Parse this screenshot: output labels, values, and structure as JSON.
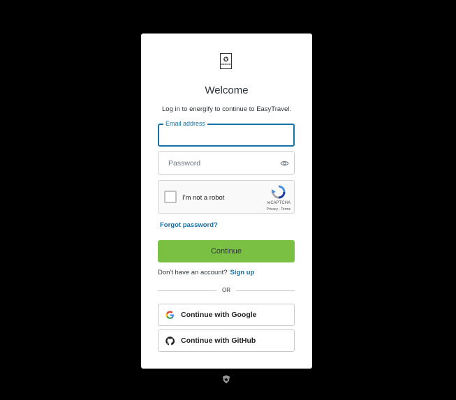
{
  "app": {
    "logo_text": "ENERGIFY",
    "logo_mark": "✪"
  },
  "header": {
    "title": "Welcome",
    "subtitle": "Log in to energify to continue to EasyTravel."
  },
  "form": {
    "email_label": "Email address",
    "email_value": "",
    "password_placeholder": "Password",
    "recaptcha": {
      "label": "I'm not a robot",
      "brand": "reCAPTCHA",
      "links": "Privacy - Terms"
    },
    "forgot_password": "Forgot password?",
    "continue_label": "Continue"
  },
  "signup": {
    "prompt": "Don't have an account?",
    "link": "Sign up"
  },
  "divider": {
    "text": "OR"
  },
  "social": {
    "google_label": "Continue with Google",
    "github_label": "Continue with GitHub"
  },
  "colors": {
    "accent": "#1672a6",
    "continue_button": "#7ac143",
    "background": "#000000"
  },
  "icons": [
    "app-logo",
    "eye-icon",
    "recaptcha-logo-icon",
    "google-icon",
    "github-icon",
    "auth0-shield-icon"
  ]
}
